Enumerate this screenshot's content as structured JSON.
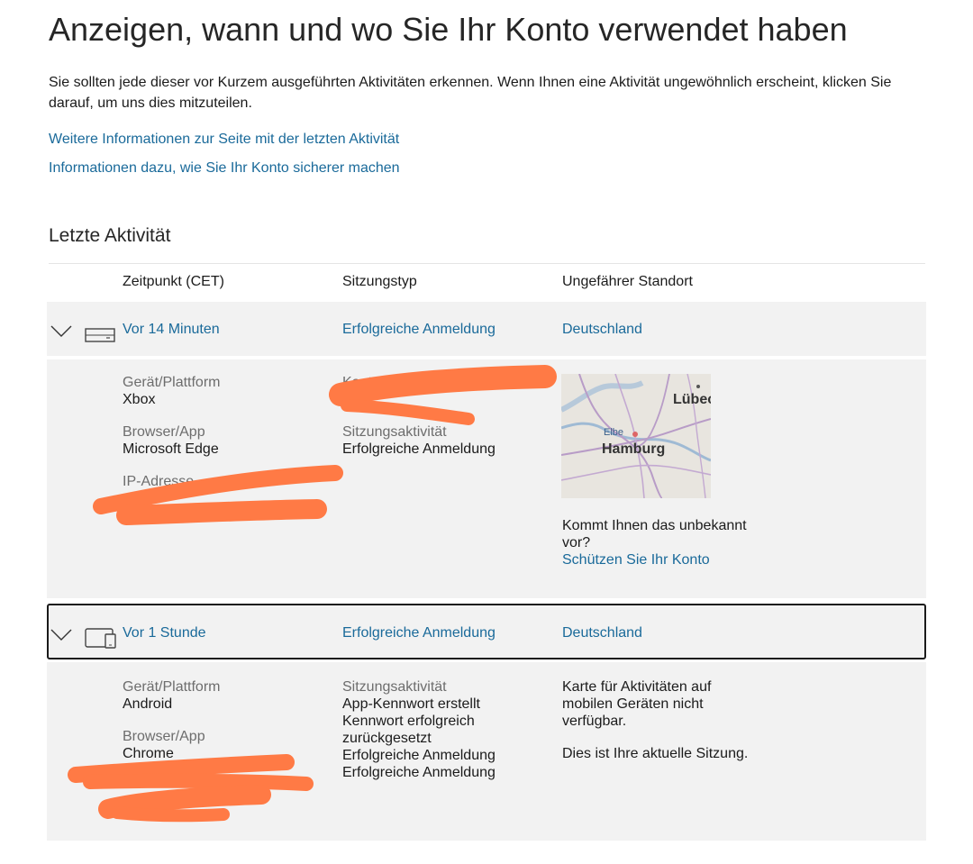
{
  "page": {
    "title": "Anzeigen, wann und wo Sie Ihr Konto verwendet haben",
    "intro": "Sie sollten jede dieser vor Kurzem ausgeführten Aktivitäten erkennen. Wenn Ihnen eine Aktivität ungewöhnlich erscheint, klicken Sie darauf, um uns dies mitzuteilen.",
    "link_recent_activity_info": "Weitere Informationen zur Seite mit der letzten Aktivität",
    "link_secure_account_info": "Informationen dazu, wie Sie Ihr Konto sicherer machen"
  },
  "activity": {
    "section_title": "Letzte Aktivität",
    "columns": {
      "time": "Zeitpunkt (CET)",
      "session_type": "Sitzungstyp",
      "location": "Ungefährer Standort"
    },
    "rows": [
      {
        "time": "Vor 14 Minuten",
        "session_type": "Erfolgreiche Anmeldung",
        "location": "Deutschland",
        "device_icon": "console-icon",
        "details": {
          "device_label": "Gerät/Plattform",
          "device_value": "Xbox",
          "browser_label": "Browser/App",
          "browser_value": "Microsoft Edge",
          "ip_label": "IP-Adresse",
          "alias_label": "Kontoalias",
          "session_activity_label": "Sitzungsaktivität",
          "session_activity_value": "Erfolgreiche Anmeldung",
          "map_city": "Hamburg",
          "map_river": "Elbe",
          "map_city_2": "Lübec",
          "unfamiliar_question": "Kommt Ihnen das unbekannt vor?",
          "protect_link": "Schützen Sie Ihr Konto"
        }
      },
      {
        "time": "Vor 1 Stunde",
        "session_type": "Erfolgreiche Anmeldung",
        "location": "Deutschland",
        "device_icon": "tablet-phone-icon",
        "details": {
          "device_label": "Gerät/Plattform",
          "device_value": "Android",
          "browser_label": "Browser/App",
          "browser_value": "Chrome",
          "session_activity_label": "Sitzungsaktivität",
          "session_activity_items": [
            "App-Kennwort erstellt",
            "Kennwort erfolgreich zurückgesetzt",
            "Erfolgreiche Anmeldung",
            "Erfolgreiche Anmeldung"
          ],
          "map_unavailable": "Karte für Aktivitäten auf mobilen Geräten nicht verfügbar.",
          "current_session": "Dies ist Ihre aktuelle Sitzung."
        }
      }
    ]
  },
  "colors": {
    "link": "#1a6a9a",
    "row_background": "#f2f2f2",
    "redaction": "#ff7a45"
  }
}
